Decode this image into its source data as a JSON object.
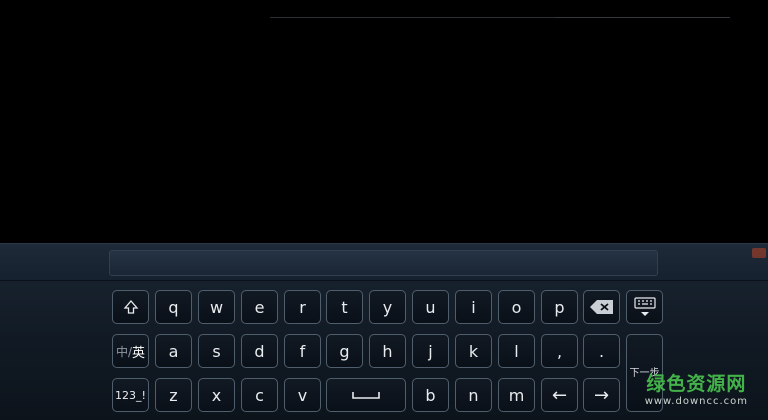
{
  "colors": {
    "background": "#000000",
    "keyboard_bg": "#111a24",
    "key_border": "#4f5e6c",
    "watermark_green": "#44b24a"
  },
  "keyboard": {
    "row1": [
      {
        "id": "shift",
        "icon": "shift-icon"
      },
      {
        "id": "q",
        "label": "q"
      },
      {
        "id": "w",
        "label": "w"
      },
      {
        "id": "e",
        "label": "e"
      },
      {
        "id": "r",
        "label": "r"
      },
      {
        "id": "t",
        "label": "t"
      },
      {
        "id": "y",
        "label": "y"
      },
      {
        "id": "u",
        "label": "u"
      },
      {
        "id": "i",
        "label": "i"
      },
      {
        "id": "o",
        "label": "o"
      },
      {
        "id": "p",
        "label": "p"
      },
      {
        "id": "backspace",
        "icon": "backspace-icon"
      },
      {
        "id": "hide-keyboard",
        "icon": "keyboard-hide-icon"
      }
    ],
    "lang_switch": {
      "zh": "中/",
      "en": "英"
    },
    "row2": [
      {
        "id": "a",
        "label": "a"
      },
      {
        "id": "s",
        "label": "s"
      },
      {
        "id": "d",
        "label": "d"
      },
      {
        "id": "f",
        "label": "f"
      },
      {
        "id": "g",
        "label": "g"
      },
      {
        "id": "h",
        "label": "h"
      },
      {
        "id": "j",
        "label": "j"
      },
      {
        "id": "k",
        "label": "k"
      },
      {
        "id": "l",
        "label": "l"
      },
      {
        "id": "comma",
        "label": ","
      },
      {
        "id": "period",
        "label": "."
      }
    ],
    "symbols_key": "123_!",
    "row3": [
      {
        "id": "z",
        "label": "z"
      },
      {
        "id": "x",
        "label": "x"
      },
      {
        "id": "c",
        "label": "c"
      },
      {
        "id": "v",
        "label": "v"
      }
    ],
    "space": {
      "icon": "space-icon"
    },
    "row3b": [
      {
        "id": "b",
        "label": "b"
      },
      {
        "id": "n",
        "label": "n"
      },
      {
        "id": "m",
        "label": "m"
      }
    ],
    "left_arrow": "←",
    "right_arrow": "→",
    "enter_label": "下一步"
  },
  "watermark": {
    "title": "绿色资源网",
    "url": "www.downcc.com"
  }
}
